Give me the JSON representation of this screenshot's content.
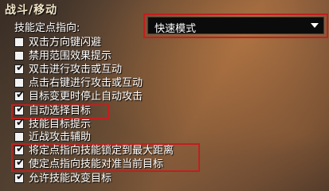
{
  "section": {
    "title": "战斗/移动"
  },
  "ability_targeting": {
    "label": "技能定点指向:",
    "selected": "快速模式"
  },
  "options": [
    {
      "label": "双击方向键闪避",
      "checked": false
    },
    {
      "label": "禁用范围效果提示",
      "checked": false
    },
    {
      "label": "双击进行攻击或互动",
      "checked": true
    },
    {
      "label": "点击右键进行攻击或互动",
      "checked": false
    },
    {
      "label": "目标变更时停止自动攻击",
      "checked": true
    },
    {
      "label": "自动选择目标",
      "checked": true
    },
    {
      "label": "技能目标提示",
      "checked": true
    },
    {
      "label": "近战攻击辅助",
      "checked": false
    },
    {
      "label": "将定点指向技能锁定到最大距离",
      "checked": true
    },
    {
      "label": "使定点指向技能对准当前目标",
      "checked": true
    },
    {
      "label": "允许技能改变目标",
      "checked": true
    }
  ],
  "colors": {
    "highlight": "#c0201f",
    "text": "#ffffff",
    "dropdown_bg": "#0b0b0b"
  },
  "icons": {
    "check": "checkmark-icon",
    "dropdown": "chevron-down-icon"
  }
}
